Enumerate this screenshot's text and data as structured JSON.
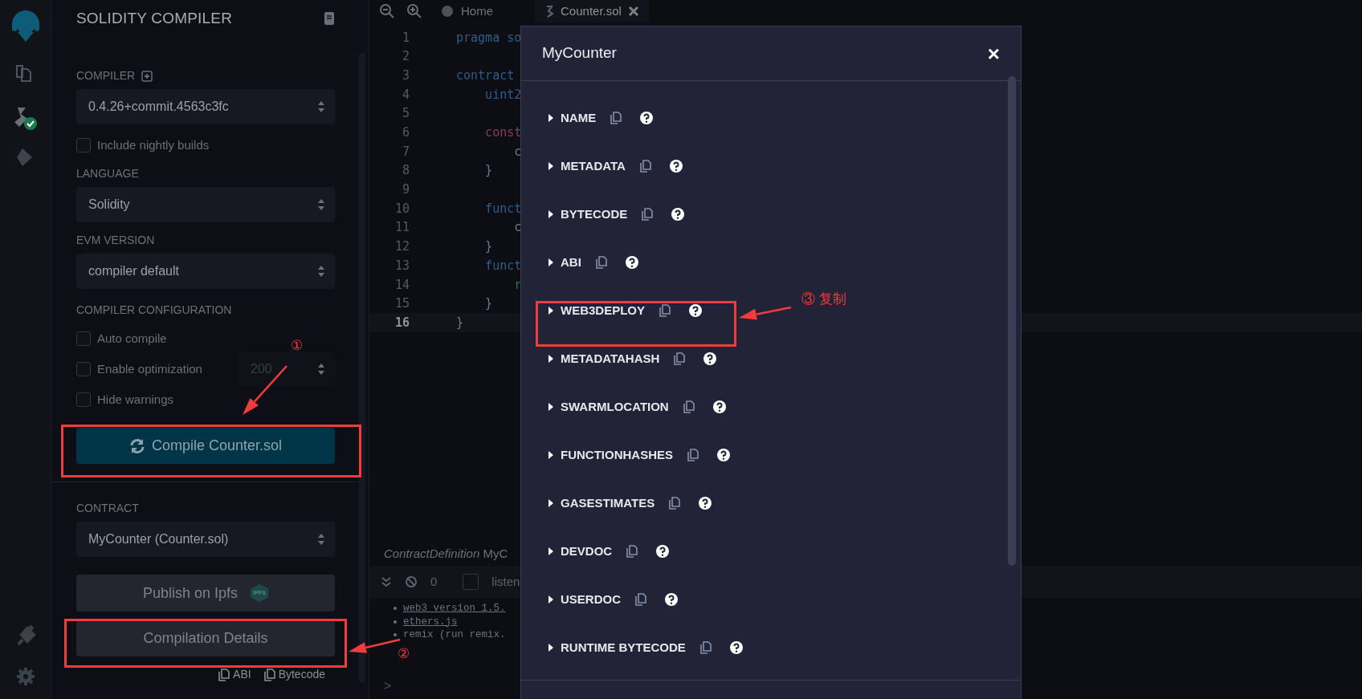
{
  "side_panel": {
    "title": "SOLIDITY COMPILER",
    "compiler": {
      "label": "COMPILER",
      "value": "0.4.26+commit.4563c3fc"
    },
    "nightly": {
      "label": "Include nightly builds",
      "checked": false
    },
    "language": {
      "label": "LANGUAGE",
      "value": "Solidity"
    },
    "evm": {
      "label": "EVM VERSION",
      "value": "compiler default"
    },
    "config_label": "COMPILER CONFIGURATION",
    "options": [
      {
        "label": "Auto compile",
        "checked": false
      },
      {
        "label": "Enable optimization",
        "checked": false,
        "runs": "200"
      },
      {
        "label": "Hide warnings",
        "checked": false
      }
    ],
    "compile_button": "Compile Counter.sol",
    "contract": {
      "label": "CONTRACT",
      "value": "MyCounter (Counter.sol)"
    },
    "publish_button": "Publish on Ipfs",
    "ipfs_badge": "IPFS",
    "details_button": "Compilation Details",
    "links": [
      {
        "label": "ABI"
      },
      {
        "label": "Bytecode"
      }
    ]
  },
  "editor": {
    "tabs": [
      {
        "label": "Home",
        "selected": false
      },
      {
        "label": "Counter.sol",
        "selected": true
      }
    ],
    "lines": [
      {
        "number": "1",
        "code": "pragma so",
        "kind": "keyword",
        "current": false
      },
      {
        "number": "2",
        "current": false
      },
      {
        "number": "3",
        "code": "contract ",
        "kind": "keyword",
        "current": false
      },
      {
        "number": "4",
        "code": "    uint2",
        "kind": "keyword",
        "current": false
      },
      {
        "number": "5",
        "current": false
      },
      {
        "number": "6",
        "code": "    const",
        "kind": "declaration",
        "current": false
      },
      {
        "number": "7",
        "code": "        c",
        "kind": "plain",
        "current": false
      },
      {
        "number": "8",
        "code": "    }",
        "kind": "plain",
        "current": false
      },
      {
        "number": "9",
        "current": false
      },
      {
        "number": "10",
        "code": "    funct",
        "kind": "keyword",
        "current": false
      },
      {
        "number": "11",
        "code": "        c",
        "kind": "plain",
        "current": false
      },
      {
        "number": "12",
        "code": "    }",
        "kind": "plain",
        "current": false
      },
      {
        "number": "13",
        "code": "    funct",
        "kind": "keyword",
        "current": false
      },
      {
        "number": "14",
        "code": "        r",
        "kind": "identifier",
        "current": false
      },
      {
        "number": "15",
        "code": "    }",
        "kind": "plain",
        "current": false
      },
      {
        "number": "16",
        "code": "}",
        "kind": "plain",
        "current": true
      }
    ]
  },
  "terminal": {
    "context": "*ContractDefinition* MyC",
    "count": "0",
    "listen": {
      "label": "listen",
      "checked": false
    },
    "logs": [
      {
        "text": "web3 version 1.5.",
        "kind": "link"
      },
      {
        "text": "ethers.js",
        "kind": "link"
      },
      {
        "text": "remix (run remix.",
        "kind": "plain"
      }
    ],
    "prompt": ">"
  },
  "modal": {
    "title": "MyCounter",
    "close": "×",
    "sections": [
      {
        "name": "NAME",
        "expanded": false
      },
      {
        "name": "METADATA",
        "expanded": false
      },
      {
        "name": "BYTECODE",
        "expanded": false
      },
      {
        "name": "ABI",
        "expanded": false
      },
      {
        "name": "WEB3DEPLOY",
        "expanded": false
      },
      {
        "name": "METADATAHASH",
        "expanded": false
      },
      {
        "name": "SWARMLOCATION",
        "expanded": false
      },
      {
        "name": "FUNCTIONHASHES",
        "expanded": false
      },
      {
        "name": "GASESTIMATES",
        "expanded": false
      },
      {
        "name": "DEVDOC",
        "expanded": false
      },
      {
        "name": "USERDOC",
        "expanded": false
      },
      {
        "name": "RUNTIME BYTECODE",
        "expanded": false
      }
    ]
  },
  "annotations": {
    "step_1": "①",
    "step_2": "②",
    "step_3": "③ 复制"
  }
}
